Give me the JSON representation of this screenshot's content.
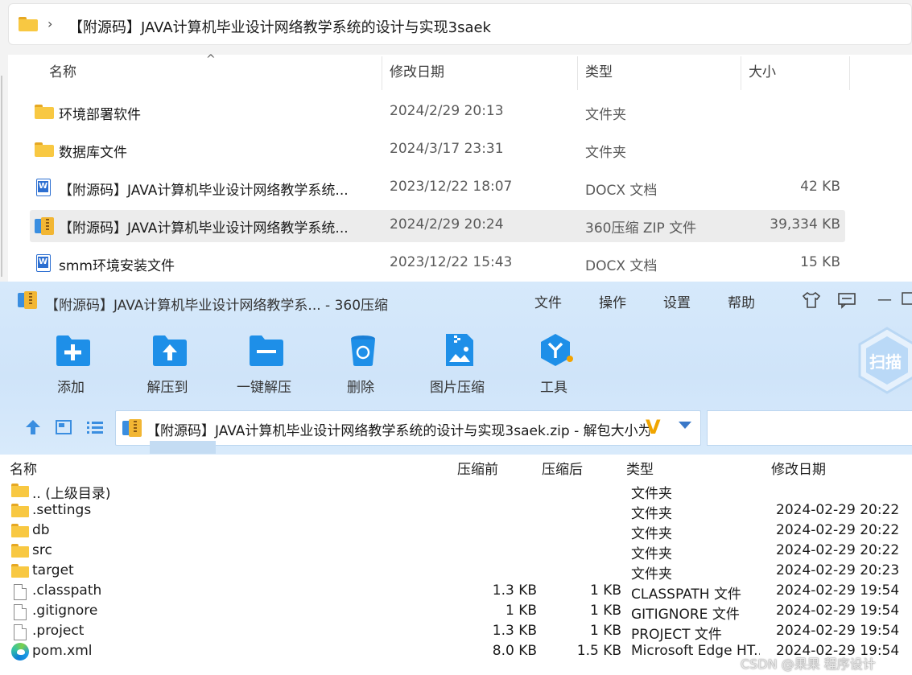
{
  "explorer": {
    "breadcrumb_sep": "›",
    "breadcrumb": "【附源码】JAVA计算机毕业设计网络教学系统的设计与实现3saek",
    "columns": {
      "name": "名称",
      "date": "修改日期",
      "type": "类型",
      "size": "大小"
    },
    "sort_indicator": "^",
    "rows": [
      {
        "name": "环境部署软件",
        "date": "2024/2/29 20:13",
        "type": "文件夹",
        "size": "",
        "icon": "folder-icon"
      },
      {
        "name": "数据库文件",
        "date": "2024/3/17 23:31",
        "type": "文件夹",
        "size": "",
        "icon": "folder-icon"
      },
      {
        "name": "【附源码】JAVA计算机毕业设计网络教学系统...",
        "date": "2023/12/22 18:07",
        "type": "DOCX 文档",
        "size": "42 KB",
        "icon": "word-doc-icon"
      },
      {
        "name": "【附源码】JAVA计算机毕业设计网络教学系统...",
        "date": "2024/2/29 20:24",
        "type": "360压缩 ZIP 文件",
        "size": "39,334 KB",
        "icon": "zip-archive-icon",
        "selected": true
      },
      {
        "name": "smm环境安装文件",
        "date": "2023/12/22 15:43",
        "type": "DOCX 文档",
        "size": "15 KB",
        "icon": "word-doc-icon"
      }
    ]
  },
  "zip": {
    "title": "【附源码】JAVA计算机毕业设计网络教学系... - 360压缩",
    "menu": [
      "文件",
      "操作",
      "设置",
      "帮助"
    ],
    "window_controls": {
      "minimize": "—"
    },
    "toolbar": [
      {
        "label": "添加",
        "icon": "add-folder-icon"
      },
      {
        "label": "解压到",
        "icon": "extract-to-icon"
      },
      {
        "label": "一键解压",
        "icon": "one-click-extract-icon"
      },
      {
        "label": "删除",
        "icon": "delete-trash-icon"
      },
      {
        "label": "图片压缩",
        "icon": "image-compress-icon"
      },
      {
        "label": "工具",
        "icon": "tools-icon"
      }
    ],
    "scan_label": "扫描",
    "path": "【附源码】JAVA计算机毕业设计网络教学系统的设计与实现3saek.zip - 解包大小为",
    "vip_mark": "V",
    "columns": {
      "name": "名称",
      "packed_before": "压缩前",
      "packed_after": "压缩后",
      "type": "类型",
      "modified": "修改日期"
    },
    "rows": [
      {
        "name": ".. (上级目录)",
        "before": "",
        "after": "",
        "type": "文件夹",
        "date": "",
        "icon": "folder"
      },
      {
        "name": ".settings",
        "before": "",
        "after": "",
        "type": "文件夹",
        "date": "2024-02-29 20:22",
        "icon": "folder"
      },
      {
        "name": "db",
        "before": "",
        "after": "",
        "type": "文件夹",
        "date": "2024-02-29 20:22",
        "icon": "folder"
      },
      {
        "name": "src",
        "before": "",
        "after": "",
        "type": "文件夹",
        "date": "2024-02-29 20:22",
        "icon": "folder"
      },
      {
        "name": "target",
        "before": "",
        "after": "",
        "type": "文件夹",
        "date": "2024-02-29 20:23",
        "icon": "folder"
      },
      {
        "name": ".classpath",
        "before": "1.3 KB",
        "after": "1 KB",
        "type": "CLASSPATH 文件",
        "date": "2024-02-29 19:54",
        "icon": "file"
      },
      {
        "name": ".gitignore",
        "before": "1 KB",
        "after": "1 KB",
        "type": "GITIGNORE 文件",
        "date": "2024-02-29 19:54",
        "icon": "file"
      },
      {
        "name": ".project",
        "before": "1.3 KB",
        "after": "1 KB",
        "type": "PROJECT 文件",
        "date": "2024-02-29 19:54",
        "icon": "file"
      },
      {
        "name": "pom.xml",
        "before": "8.0 KB",
        "after": "1.5 KB",
        "type": "Microsoft Edge HT...",
        "date": "2024-02-29 19:54",
        "icon": "edge"
      }
    ]
  },
  "watermark": "CSDN @果果 程序设计",
  "colors": {
    "accent": "#2f7fd6",
    "toolbar_bg": "#d6e9fb",
    "folder": "#f8c842"
  }
}
